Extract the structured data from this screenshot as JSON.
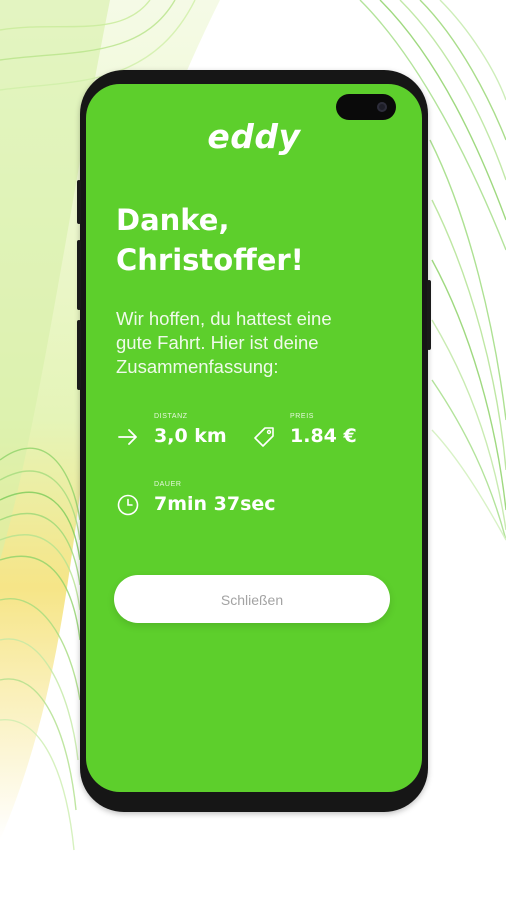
{
  "app": {
    "logo_text": "eddy"
  },
  "summary": {
    "title_line1": "Danke,",
    "title_line2": "Christoffer!",
    "intro_line1": "Wir hoffen, du hattest eine",
    "intro_line2": "gute Fahrt. Hier ist deine",
    "intro_line3": "Zusammenfassung:"
  },
  "stats": {
    "distance": {
      "label": "DISTANZ",
      "value": "3,0 km",
      "icon": "arrow-right-icon"
    },
    "price": {
      "label": "PREIS",
      "value": "1.84 €",
      "icon": "price-tag-icon"
    },
    "duration": {
      "label": "DAUER",
      "value": "7min 37sec",
      "icon": "clock-icon"
    }
  },
  "actions": {
    "close_label": "Schließen"
  },
  "colors": {
    "brand_green": "#5dcf2c",
    "text_on_green": "#ffffff",
    "button_text": "#a3a3a3",
    "phone_frame": "#161616"
  }
}
